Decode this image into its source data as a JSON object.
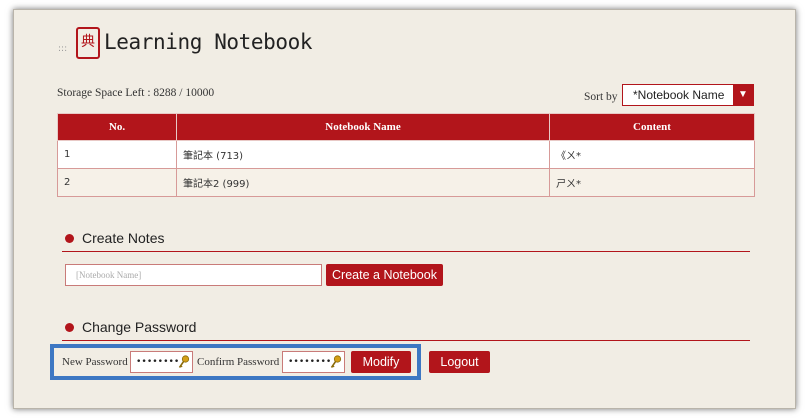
{
  "header": {
    "menu_glyph": ":::",
    "seal_char": "典",
    "title": "Learning Notebook"
  },
  "storage": {
    "text": "Storage Space Left : 8288 / 10000"
  },
  "sort": {
    "label": "Sort by",
    "selected": "*Notebook Name",
    "arrow": "▼"
  },
  "table": {
    "headers": [
      "No.",
      "Notebook Name",
      "Content"
    ],
    "rows": [
      {
        "no": "1",
        "name": "筆記本 (713)",
        "content": "《ㄨ*"
      },
      {
        "no": "2",
        "name": "筆記本2 (999)",
        "content": "ㄕㄨ*"
      }
    ]
  },
  "create_notes": {
    "title": "Create Notes",
    "input_placeholder": "[Notebook Name]",
    "button": "Create a Notebook"
  },
  "change_password": {
    "title": "Change Password",
    "new_label": "New Password",
    "new_value": "••••••••",
    "confirm_label": "Confirm Password",
    "confirm_value": "••••••••",
    "modify_button": "Modify",
    "logout_button": "Logout"
  },
  "colors": {
    "accent": "#b2151b",
    "background": "#f1ede4",
    "highlight": "#3d77c3"
  }
}
